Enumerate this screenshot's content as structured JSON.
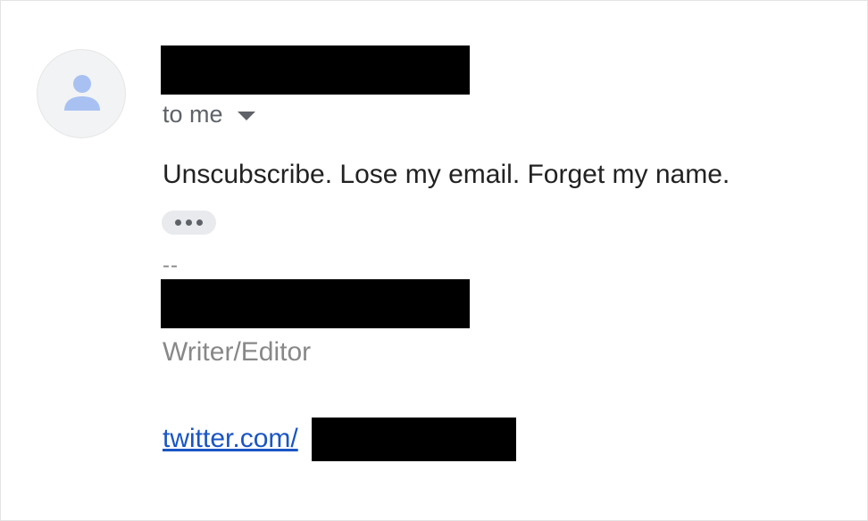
{
  "email": {
    "recipient_label": "to me",
    "body": "Unscubscribe. Lose my email. Forget my name.",
    "signature": {
      "separator": "--",
      "title": "Writer/Editor",
      "link_text": "twitter.com/"
    }
  },
  "icons": {
    "avatar": "person-icon",
    "recipient_dropdown": "caret-down-icon",
    "show_trimmed": "ellipsis-icon"
  },
  "colors": {
    "link": "#1a55c4",
    "avatar_icon": "#a8c1f2",
    "muted_text": "#888888"
  }
}
